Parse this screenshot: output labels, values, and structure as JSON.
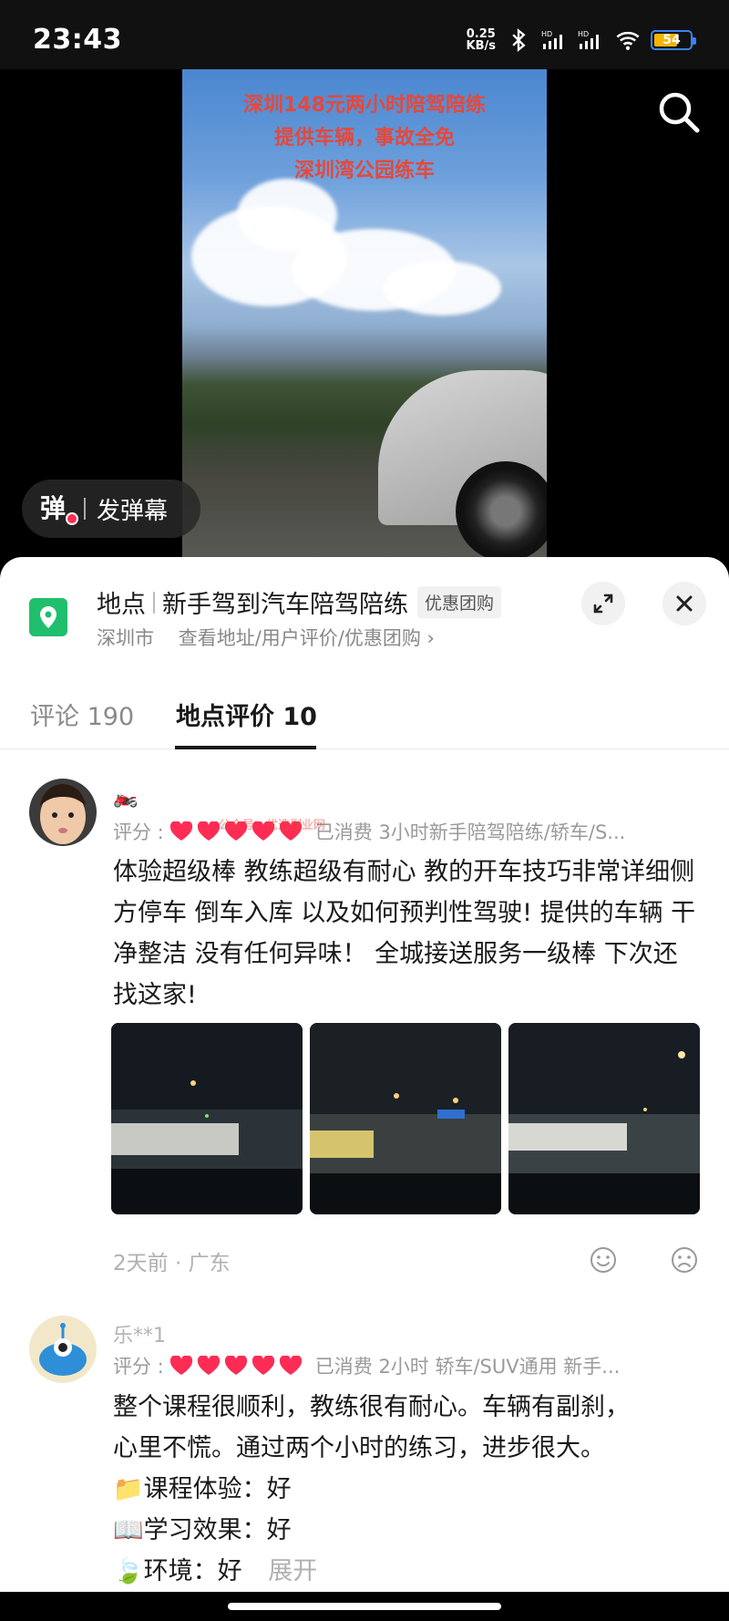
{
  "status_bar": {
    "time": "23:43",
    "net_speed_value": "0.25",
    "net_speed_unit": "KB/s",
    "battery": "54"
  },
  "video": {
    "overlay_line1": "深圳148元两小时陪驾陪练",
    "overlay_line2": "提供车辆，事故全免",
    "overlay_line3": "深圳湾公园练车",
    "danmu_icon": "弹",
    "danmu_label": "发弹幕"
  },
  "location": {
    "prefix": "地点",
    "name": "新手驾到汽车陪驾陪练",
    "tag": "优惠团购",
    "city": "深圳市",
    "link": "查看地址/用户评价/优惠团购 ›"
  },
  "tabs": {
    "comments": "评论 190",
    "reviews": "地点评价 10"
  },
  "reviews": [
    {
      "username": "🏍️",
      "rating_label": "评分 :",
      "hearts": 5,
      "purchase": "已消费 3小时新手陪驾陪练/轿车/S...",
      "text": "体验超级棒 教练超级有耐心 教的开车技巧非常详细侧方停车 倒车入库 以及如何预判性驾驶! 提供的车辆 干净整洁 没有任何异味！ 全城接送服务一级棒 下次还找这家!",
      "watermark": "公众号：优选副业网",
      "time_location": "2天前 · 广东"
    },
    {
      "username": "乐**1",
      "rating_label": "评分 :",
      "hearts": 5,
      "purchase": "已消费 2小时 轿车/SUV通用 新手...",
      "line1": "整个课程很顺利，教练很有耐心。车辆有副刹，",
      "line2": "心里不慌。通过两个小时的练习，进步很大。",
      "line3": "📁课程体验：好",
      "line4": "📖学习效果：好",
      "line5": "🍃环境：好",
      "expand": "展开"
    }
  ],
  "colors": {
    "accent": "#1fbf6e",
    "heart": "#fe2c55",
    "overlay_text": "#e6483b"
  }
}
